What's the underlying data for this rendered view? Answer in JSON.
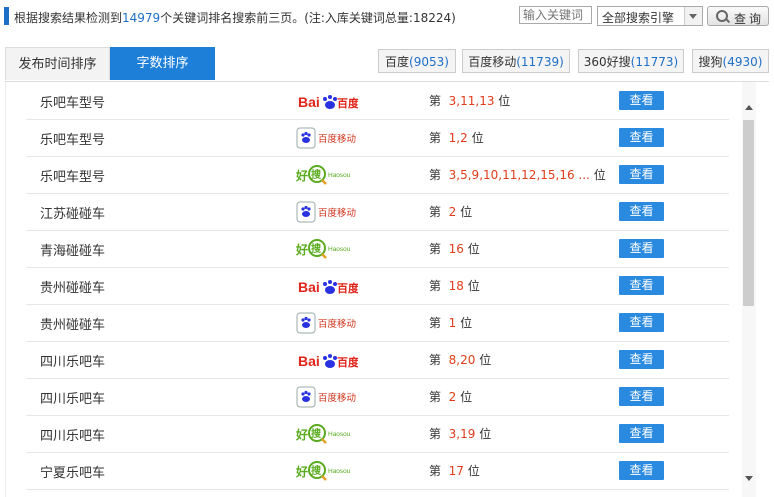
{
  "header": {
    "prefix": "根据搜索结果检测到",
    "count": "14979",
    "suffix": "个关键词排名搜索前三页。(注:入库关键词总量:18224)",
    "keyword_placeholder": "输入关键词",
    "engine_select": "全部搜索引擎",
    "query_label": "查询"
  },
  "tabs": {
    "time": "发布时间排序",
    "words": "字数排序"
  },
  "engines": [
    {
      "name": "百度",
      "count": "(9053)"
    },
    {
      "name": "百度移动",
      "count": "(11739)"
    },
    {
      "name": "360好搜",
      "count": "(11773)"
    },
    {
      "name": "搜狗",
      "count": "(4930)"
    }
  ],
  "rows": [
    {
      "keyword": "乐吧车型号",
      "engine": "baidu",
      "rank_prefix": "第",
      "ranks": "3,11,13",
      "rank_suffix": "位",
      "action": "查看"
    },
    {
      "keyword": "乐吧车型号",
      "engine": "baidu-mobile",
      "rank_prefix": "第",
      "ranks": "1,2",
      "rank_suffix": "位",
      "action": "查看"
    },
    {
      "keyword": "乐吧车型号",
      "engine": "haosou",
      "rank_prefix": "第",
      "ranks": "3,5,9,10,11,12,15,16 ...",
      "rank_suffix": "位",
      "action": "查看"
    },
    {
      "keyword": "江苏碰碰车",
      "engine": "baidu-mobile",
      "rank_prefix": "第",
      "ranks": "2",
      "rank_suffix": "位",
      "action": "查看"
    },
    {
      "keyword": "青海碰碰车",
      "engine": "haosou",
      "rank_prefix": "第",
      "ranks": "16",
      "rank_suffix": "位",
      "action": "查看"
    },
    {
      "keyword": "贵州碰碰车",
      "engine": "baidu",
      "rank_prefix": "第",
      "ranks": "18",
      "rank_suffix": "位",
      "action": "查看"
    },
    {
      "keyword": "贵州碰碰车",
      "engine": "baidu-mobile",
      "rank_prefix": "第",
      "ranks": "1",
      "rank_suffix": "位",
      "action": "查看"
    },
    {
      "keyword": "四川乐吧车",
      "engine": "baidu",
      "rank_prefix": "第",
      "ranks": "8,20",
      "rank_suffix": "位",
      "action": "查看"
    },
    {
      "keyword": "四川乐吧车",
      "engine": "baidu-mobile",
      "rank_prefix": "第",
      "ranks": "2",
      "rank_suffix": "位",
      "action": "查看"
    },
    {
      "keyword": "四川乐吧车",
      "engine": "haosou",
      "rank_prefix": "第",
      "ranks": "3,19",
      "rank_suffix": "位",
      "action": "查看"
    },
    {
      "keyword": "宁夏乐吧车",
      "engine": "haosou",
      "rank_prefix": "第",
      "ranks": "17",
      "rank_suffix": "位",
      "action": "查看"
    }
  ],
  "logos": {
    "baidu": {
      "a": "Bai",
      "b": "百度",
      "color_red": "#e0251b",
      "color_blue": "#2932e1"
    },
    "baidu-mobile": {
      "text": "百度移动",
      "color": "#d0341c"
    },
    "haosou": {
      "a": "好",
      "b": "搜",
      "c": "Haosou",
      "color": "#5aab1f"
    }
  },
  "colors": {
    "accent": "#1e7fd8",
    "rank": "#e03c1c",
    "count": "#1e6fc8"
  }
}
